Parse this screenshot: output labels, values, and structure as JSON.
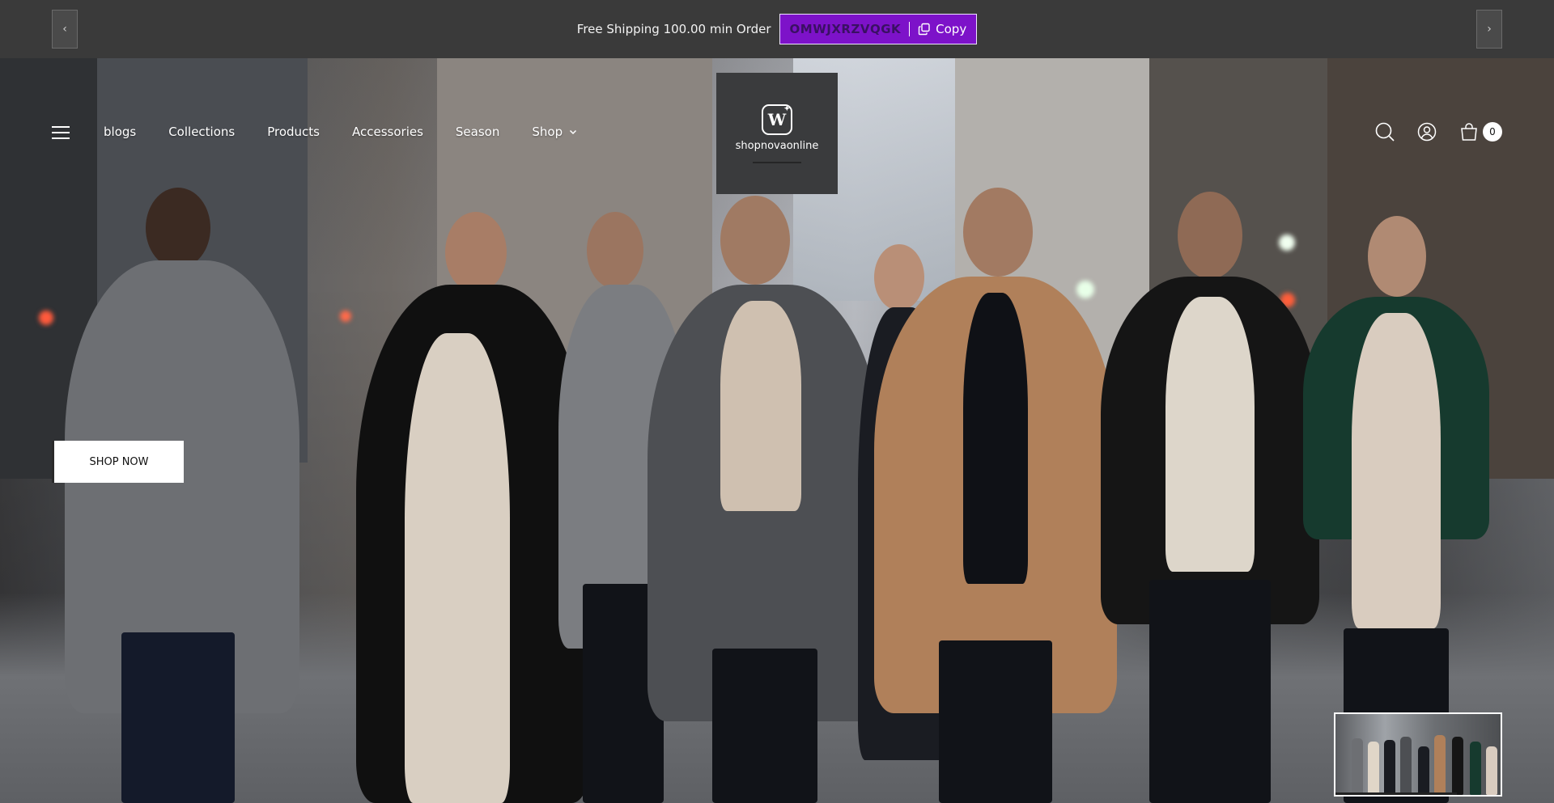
{
  "announcement": {
    "text": "Free Shipping 100.00 min Order",
    "coupon_code": "OMWJXRZVQGK",
    "copy_label": "Copy",
    "prev_label": "‹",
    "next_label": "›"
  },
  "colors": {
    "coupon_bg": "#7d12c9",
    "bar_bg": "#3a3a3a",
    "logo_bg": "#3a3b3d"
  },
  "nav": {
    "items": [
      {
        "label": "blogs"
      },
      {
        "label": "Collections"
      },
      {
        "label": "Products"
      },
      {
        "label": "Accessories"
      },
      {
        "label": "Season"
      },
      {
        "label": "Shop"
      }
    ]
  },
  "logo": {
    "mark": "W",
    "text": "shopnovaonline"
  },
  "header": {
    "cart_count": "0",
    "icons": [
      "search-icon",
      "account-icon",
      "cart-icon"
    ]
  },
  "hero": {
    "cta_label": "SHOP NOW"
  }
}
